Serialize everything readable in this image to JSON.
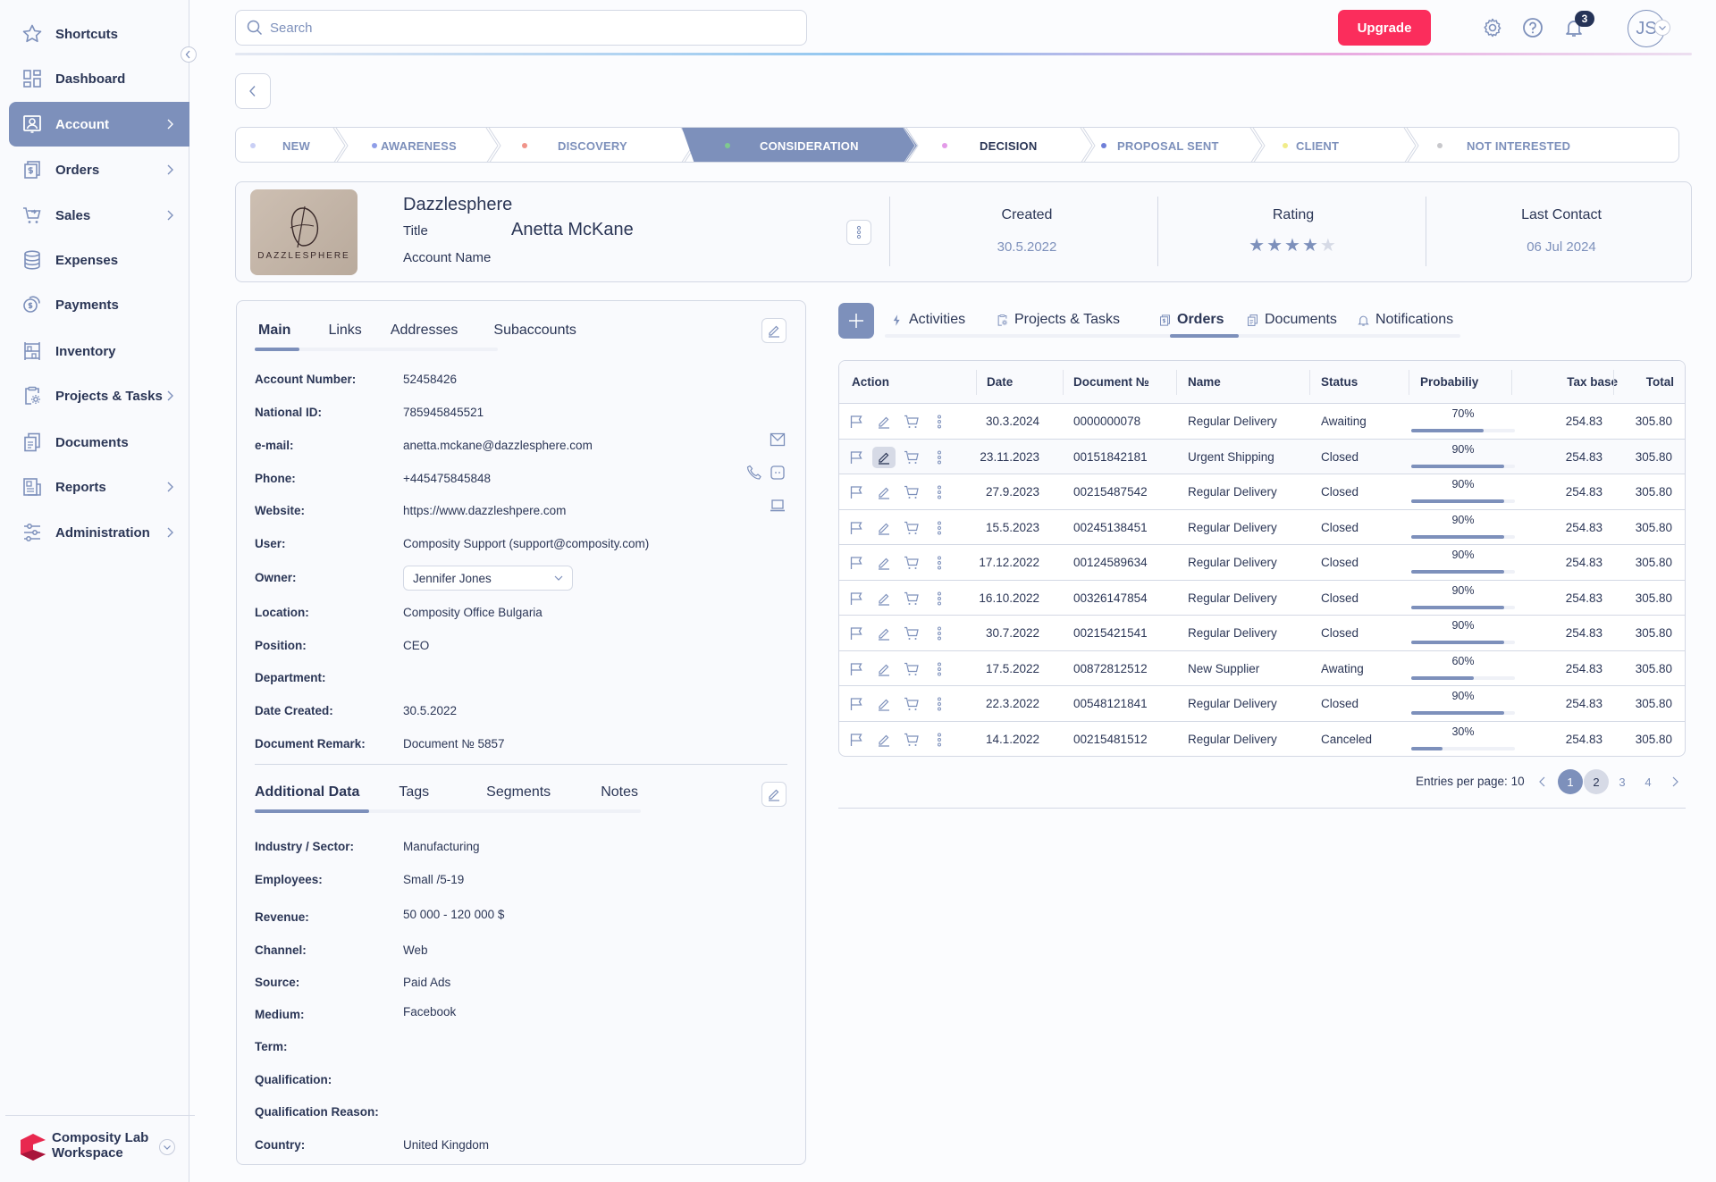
{
  "sidebar": {
    "items": [
      {
        "label": "Shortcuts",
        "icon": "star-icon",
        "has_chevron": false
      },
      {
        "label": "Dashboard",
        "icon": "dashboard-icon",
        "has_chevron": false
      },
      {
        "label": "Account",
        "icon": "account-icon",
        "has_chevron": true,
        "active": true
      },
      {
        "label": "Orders",
        "icon": "orders-icon",
        "has_chevron": true
      },
      {
        "label": "Sales",
        "icon": "cart-icon",
        "has_chevron": true
      },
      {
        "label": "Expenses",
        "icon": "database-icon",
        "has_chevron": false
      },
      {
        "label": "Payments",
        "icon": "coins-icon",
        "has_chevron": false
      },
      {
        "label": "Inventory",
        "icon": "shelves-icon",
        "has_chevron": false
      },
      {
        "label": "Projects & Tasks",
        "icon": "clipboard-gear-icon",
        "has_chevron": true
      },
      {
        "label": "Documents",
        "icon": "documents-icon",
        "has_chevron": false
      },
      {
        "label": "Reports",
        "icon": "report-icon",
        "has_chevron": true
      },
      {
        "label": "Administration",
        "icon": "sliders-icon",
        "has_chevron": true
      }
    ],
    "workspace": {
      "line1": "Composity Lab",
      "line2": "Workspace"
    }
  },
  "topbar": {
    "search_placeholder": "Search",
    "upgrade_label": "Upgrade",
    "notification_count": "3",
    "avatar_initials": "JS"
  },
  "colors": {
    "accent": "#7d90bb",
    "upgrade": "#fb2d5c",
    "text": "#2b3656"
  },
  "pipeline": {
    "stages": [
      {
        "label": "NEW",
        "dot": "#c9cff5"
      },
      {
        "label": "AWARENESS",
        "dot": "#8f9ee8"
      },
      {
        "label": "DISCOVERY",
        "dot": "#f0948a"
      },
      {
        "label": "CONSIDERATION",
        "dot": "#7fc98f",
        "active": true
      },
      {
        "label": "DECISION",
        "dot": "#e39be8"
      },
      {
        "label": "PROPOSAL SENT",
        "dot": "#6f7fd8"
      },
      {
        "label": "CLIENT",
        "dot": "#f1ec8a"
      },
      {
        "label": "NOT INTERESTED",
        "dot": "#c8c8cc"
      }
    ]
  },
  "account": {
    "logo_text": "DAZZLESPHERE",
    "logo_letter": "D",
    "name": "Dazzlesphere",
    "title_label": "Title",
    "person": "Anetta McKane",
    "account_name_label": "Account Name",
    "stats": [
      {
        "label": "Created",
        "value": "30.5.2022"
      },
      {
        "label": "Rating",
        "value": "4 / 5",
        "rating": 4,
        "max": 5
      },
      {
        "label": "Last Contact",
        "value": "06 Jul 2024"
      }
    ]
  },
  "main_panel": {
    "tabs": [
      "Main",
      "Links",
      "Addresses",
      "Subaccounts"
    ],
    "active_tab": "Main",
    "fields": [
      {
        "label": "Account Number:",
        "value": "52458426"
      },
      {
        "label": "National ID:",
        "value": "785945845521"
      },
      {
        "label": "e-mail:",
        "value": "anetta.mckane@dazzlesphere.com"
      },
      {
        "label": "Phone:",
        "value": "+445475845848"
      },
      {
        "label": "Website:",
        "value": "https://www.dazzleshpere.com"
      },
      {
        "label": "User:",
        "value": "Composity Support (support@composity.com)"
      },
      {
        "label": "Owner:",
        "value": "Jennifer Jones"
      },
      {
        "label": "Location:",
        "value": "Composity Office Bulgaria"
      },
      {
        "label": "Position:",
        "value": "CEO"
      },
      {
        "label": "Department:",
        "value": ""
      },
      {
        "label": "Date Created:",
        "value": "30.5.2022"
      },
      {
        "label": "Document Remark:",
        "value": "Document № 5857"
      }
    ]
  },
  "additional_panel": {
    "tabs": [
      "Additional Data",
      "Tags",
      "Segments",
      "Notes"
    ],
    "active_tab": "Additional Data",
    "fields": [
      {
        "label": "Industry / Sector:",
        "value": "Manufacturing"
      },
      {
        "label": "Employees:",
        "value": "Small /5-19"
      },
      {
        "label": "Revenue:",
        "value": "50 000 - 120 000 $"
      },
      {
        "label": "Channel:",
        "value": "Web"
      },
      {
        "label": "Source:",
        "value": "Paid Ads"
      },
      {
        "label": "Medium:",
        "value": "Facebook"
      },
      {
        "label": "Term:",
        "value": ""
      },
      {
        "label": "Qualification:",
        "value": ""
      },
      {
        "label": "Qualification Reason:",
        "value": ""
      },
      {
        "label": "Country:",
        "value": "United Kingdom"
      }
    ]
  },
  "right_tabs": {
    "items": [
      {
        "label": "Activities",
        "icon": "bolt-icon"
      },
      {
        "label": "Projects & Tasks",
        "icon": "clipboard-gear-icon"
      },
      {
        "label": "Orders",
        "icon": "orders-icon",
        "active": true
      },
      {
        "label": "Documents",
        "icon": "documents-icon"
      },
      {
        "label": "Notifications",
        "icon": "bell-icon"
      }
    ]
  },
  "orders": {
    "columns": [
      "Action",
      "Date",
      "Document №",
      "Name",
      "Status",
      "Probabiliy",
      "Tax base",
      "Total"
    ],
    "rows": [
      {
        "date": "30.3.2024",
        "doc": "0000000078",
        "name": "Regular Delivery",
        "status": "Awaiting",
        "prob": 70,
        "prob_label": "70%",
        "tax": "254.83",
        "total": "305.80"
      },
      {
        "date": "23.11.2023",
        "doc": "00151842181",
        "name": "Urgent Shipping",
        "status": "Closed",
        "prob": 90,
        "prob_label": "90%",
        "tax": "254.83",
        "total": "305.80"
      },
      {
        "date": "27.9.2023",
        "doc": "00215487542",
        "name": "Regular Delivery",
        "status": "Closed",
        "prob": 90,
        "prob_label": "90%",
        "tax": "254.83",
        "total": "305.80"
      },
      {
        "date": "15.5.2023",
        "doc": "00245138451",
        "name": "Regular Delivery",
        "status": "Closed",
        "prob": 90,
        "prob_label": "90%",
        "tax": "254.83",
        "total": "305.80"
      },
      {
        "date": "17.12.2022",
        "doc": "00124589634",
        "name": "Regular Delivery",
        "status": "Closed",
        "prob": 90,
        "prob_label": "90%",
        "tax": "254.83",
        "total": "305.80"
      },
      {
        "date": "16.10.2022",
        "doc": "00326147854",
        "name": "Regular Delivery",
        "status": "Closed",
        "prob": 90,
        "prob_label": "90%",
        "tax": "254.83",
        "total": "305.80"
      },
      {
        "date": "30.7.2022",
        "doc": "00215421541",
        "name": "Regular Delivery",
        "status": "Closed",
        "prob": 90,
        "prob_label": "90%",
        "tax": "254.83",
        "total": "305.80"
      },
      {
        "date": "17.5.2022",
        "doc": "00872812512",
        "name": "New Supplier",
        "status": "Awating",
        "prob": 60,
        "prob_label": "60%",
        "tax": "254.83",
        "total": "305.80"
      },
      {
        "date": "22.3.2022",
        "doc": "00548121841",
        "name": "Regular Delivery",
        "status": "Closed",
        "prob": 90,
        "prob_label": "90%",
        "tax": "254.83",
        "total": "305.80"
      },
      {
        "date": "14.1.2022",
        "doc": "00215481512",
        "name": "Regular Delivery",
        "status": "Canceled",
        "prob": 30,
        "prob_label": "30%",
        "tax": "254.83",
        "total": "305.80"
      }
    ],
    "pagination": {
      "entries_label": "Entries per page: 10",
      "pages": [
        "1",
        "2",
        "3",
        "4"
      ],
      "current": "1"
    }
  }
}
